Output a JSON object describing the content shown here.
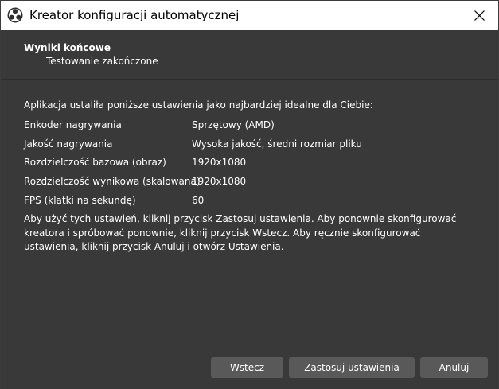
{
  "window": {
    "title": "Kreator konfiguracji automatycznej",
    "app_icon": "obs-icon",
    "close_icon": "close-icon"
  },
  "page": {
    "title": "Wyniki końcowe",
    "subtitle": "Testowanie zakończone",
    "intro": "Aplikacja ustaliła poniższe ustawienia jako najbardziej idealne dla Ciebie:"
  },
  "settings": [
    {
      "label": "Enkoder nagrywania",
      "value": "Sprzętowy (AMD)"
    },
    {
      "label": "Jakość nagrywania",
      "value": "Wysoka jakość, średni rozmiar pliku"
    },
    {
      "label": "Rozdzielczość bazowa (obraz)",
      "value": "1920x1080"
    },
    {
      "label": "Rozdzielczość wynikowa (skalowana)",
      "value": "1920x1080"
    },
    {
      "label": "FPS (klatki na sekundę)",
      "value": "60"
    }
  ],
  "note": "Aby użyć tych ustawień, kliknij przycisk Zastosuj ustawienia. Aby ponownie skonfigurować kreatora i spróbować ponownie, kliknij przycisk Wstecz. Aby ręcznie skonfigurować ustawienia, kliknij przycisk Anuluj i otwórz Ustawienia.",
  "buttons": {
    "back": "Wstecz",
    "apply": "Zastosuj ustawienia",
    "cancel": "Anuluj"
  },
  "colors": {
    "background": "#3a393a",
    "button": "#5a595a",
    "text": "#ffffff",
    "titlebar": "#ffffff"
  }
}
